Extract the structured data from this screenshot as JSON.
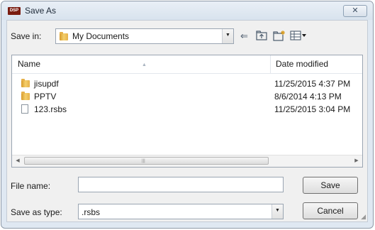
{
  "window": {
    "title": "Save As",
    "app_badge": "DSP",
    "close_glyph": "✕"
  },
  "toolbar": {
    "save_in_label": "Save in:",
    "location": "My Documents",
    "back_icon": "arrow-left-icon",
    "up_icon": "folder-up-icon",
    "new_folder_icon": "new-folder-icon",
    "views_icon": "views-menu-icon"
  },
  "file_list": {
    "columns": {
      "name": "Name",
      "date": "Date modified"
    },
    "rows": [
      {
        "name": "jisupdf",
        "date": "11/25/2015 4:37 PM",
        "icon": "folder-icon"
      },
      {
        "name": "PPTV",
        "date": "8/6/2014 4:13 PM",
        "icon": "folder-icon"
      },
      {
        "name": "123.rsbs",
        "date": "11/25/2015 3:04 PM",
        "icon": "file-icon"
      }
    ]
  },
  "form": {
    "file_name_label": "File name:",
    "file_name_value": "",
    "save_type_label": "Save as type:",
    "save_type_value": ".rsbs"
  },
  "buttons": {
    "save": "Save",
    "cancel": "Cancel"
  },
  "colors": {
    "title_bg": "#dfe8f2",
    "app_icon": "#7a1c10",
    "folder": "#e6b14a"
  }
}
